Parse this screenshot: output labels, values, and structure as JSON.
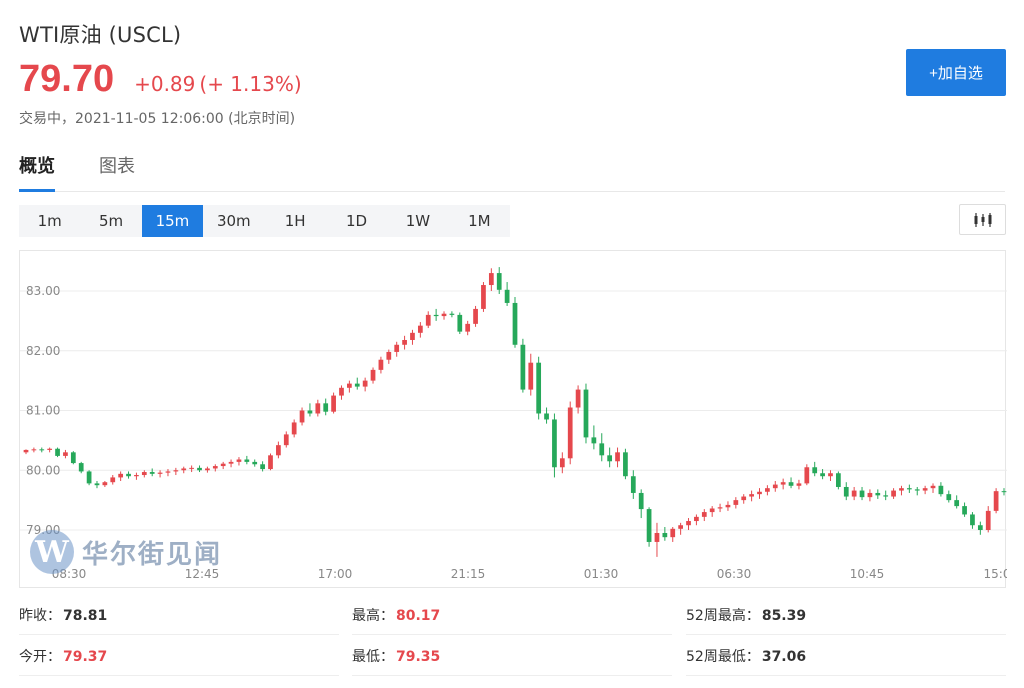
{
  "header": {
    "title": "WTI原油 (USCL)",
    "price": "79.70",
    "change": "+0.89",
    "change_pct": "(+ 1.13%)",
    "status": "交易中，2021-11-05 12:06:00 (北京时间)",
    "add_button": "+加自选"
  },
  "tabs": [
    {
      "label": "概览",
      "active": true
    },
    {
      "label": "图表",
      "active": false
    }
  ],
  "periods": [
    {
      "label": "1m",
      "active": false
    },
    {
      "label": "5m",
      "active": false
    },
    {
      "label": "15m",
      "active": true
    },
    {
      "label": "30m",
      "active": false
    },
    {
      "label": "1H",
      "active": false
    },
    {
      "label": "1D",
      "active": false
    },
    {
      "label": "1W",
      "active": false
    },
    {
      "label": "1M",
      "active": false
    }
  ],
  "watermark": {
    "logo": "W",
    "text": "华尔街见闻"
  },
  "stats": {
    "prev_close_label": "昨收：",
    "prev_close": "78.81",
    "high_label": "最高：",
    "high": "80.17",
    "high52_label": "52周最高：",
    "high52": "85.39",
    "open_label": "今开：",
    "open": "79.37",
    "low_label": "最低：",
    "low": "79.35",
    "low52_label": "52周最低：",
    "low52": "37.06"
  },
  "colors": {
    "up": "#e5484d",
    "down": "#26a85a",
    "accent": "#1f7ce0"
  },
  "chart_data": {
    "type": "candlestick",
    "y_ticks": [
      "83.00",
      "82.00",
      "81.00",
      "80.00",
      "79.00"
    ],
    "x_ticks": [
      "08:30",
      "12:45",
      "17:00",
      "21:15",
      "01:30",
      "06:30",
      "10:45",
      "15:0"
    ],
    "ylim": [
      78.55,
      83.75
    ],
    "grid": true,
    "candles": [
      [
        80.3,
        80.35,
        80.27,
        80.34
      ],
      [
        80.34,
        80.38,
        80.3,
        80.35
      ],
      [
        80.35,
        80.38,
        80.3,
        80.34
      ],
      [
        80.34,
        80.38,
        80.3,
        80.36
      ],
      [
        80.36,
        80.38,
        80.22,
        80.24
      ],
      [
        80.24,
        80.34,
        80.2,
        80.3
      ],
      [
        80.3,
        80.32,
        80.1,
        80.12
      ],
      [
        80.12,
        80.14,
        79.95,
        79.98
      ],
      [
        79.98,
        80.0,
        79.75,
        79.78
      ],
      [
        79.78,
        79.82,
        79.7,
        79.75
      ],
      [
        79.75,
        79.82,
        79.72,
        79.8
      ],
      [
        79.8,
        79.92,
        79.76,
        79.88
      ],
      [
        79.88,
        79.98,
        79.82,
        79.94
      ],
      [
        79.94,
        79.98,
        79.86,
        79.9
      ],
      [
        79.9,
        79.96,
        79.84,
        79.92
      ],
      [
        79.92,
        80.0,
        79.88,
        79.97
      ],
      [
        79.97,
        80.03,
        79.9,
        79.94
      ],
      [
        79.94,
        80.0,
        79.88,
        79.96
      ],
      [
        79.96,
        80.02,
        79.9,
        79.98
      ],
      [
        79.98,
        80.04,
        79.92,
        80.0
      ],
      [
        80.0,
        80.06,
        79.95,
        80.03
      ],
      [
        80.03,
        80.08,
        79.97,
        80.04
      ],
      [
        80.04,
        80.08,
        79.97,
        80.0
      ],
      [
        80.0,
        80.06,
        79.96,
        80.03
      ],
      [
        80.03,
        80.1,
        79.98,
        80.07
      ],
      [
        80.07,
        80.14,
        80.02,
        80.11
      ],
      [
        80.11,
        80.18,
        80.05,
        80.14
      ],
      [
        80.14,
        80.22,
        80.08,
        80.18
      ],
      [
        80.18,
        80.24,
        80.1,
        80.14
      ],
      [
        80.14,
        80.18,
        80.06,
        80.1
      ],
      [
        80.1,
        80.15,
        79.98,
        80.02
      ],
      [
        80.02,
        80.28,
        80.0,
        80.25
      ],
      [
        80.25,
        80.48,
        80.2,
        80.42
      ],
      [
        80.42,
        80.65,
        80.38,
        80.6
      ],
      [
        80.6,
        80.85,
        80.55,
        80.8
      ],
      [
        80.8,
        81.05,
        80.75,
        81.0
      ],
      [
        81.0,
        81.12,
        80.9,
        80.95
      ],
      [
        80.95,
        81.18,
        80.9,
        81.12
      ],
      [
        81.12,
        81.2,
        80.92,
        80.98
      ],
      [
        80.98,
        81.3,
        80.95,
        81.25
      ],
      [
        81.25,
        81.42,
        81.18,
        81.38
      ],
      [
        81.38,
        81.5,
        81.3,
        81.45
      ],
      [
        81.45,
        81.55,
        81.35,
        81.4
      ],
      [
        81.4,
        81.55,
        81.32,
        81.5
      ],
      [
        81.5,
        81.72,
        81.45,
        81.68
      ],
      [
        81.68,
        81.9,
        81.62,
        81.85
      ],
      [
        81.85,
        82.02,
        81.78,
        81.98
      ],
      [
        81.98,
        82.15,
        81.9,
        82.1
      ],
      [
        82.1,
        82.25,
        82.02,
        82.18
      ],
      [
        82.18,
        82.35,
        82.1,
        82.3
      ],
      [
        82.3,
        82.48,
        82.22,
        82.42
      ],
      [
        82.42,
        82.66,
        82.38,
        82.6
      ],
      [
        82.6,
        82.7,
        82.5,
        82.58
      ],
      [
        82.58,
        82.66,
        82.52,
        82.62
      ],
      [
        82.62,
        82.66,
        82.56,
        82.6
      ],
      [
        82.6,
        82.64,
        82.28,
        82.32
      ],
      [
        82.32,
        82.5,
        82.26,
        82.45
      ],
      [
        82.45,
        82.75,
        82.4,
        82.7
      ],
      [
        82.7,
        83.15,
        82.65,
        83.1
      ],
      [
        83.1,
        83.38,
        83.0,
        83.3
      ],
      [
        83.3,
        83.4,
        82.95,
        83.02
      ],
      [
        83.02,
        83.15,
        82.75,
        82.8
      ],
      [
        82.8,
        82.9,
        82.05,
        82.1
      ],
      [
        82.1,
        82.2,
        81.3,
        81.35
      ],
      [
        81.35,
        81.95,
        81.25,
        81.8
      ],
      [
        81.8,
        81.9,
        80.85,
        80.95
      ],
      [
        80.95,
        81.05,
        80.78,
        80.85
      ],
      [
        80.85,
        80.95,
        79.88,
        80.05
      ],
      [
        80.05,
        80.3,
        79.95,
        80.2
      ],
      [
        80.2,
        81.15,
        80.1,
        81.05
      ],
      [
        81.05,
        81.42,
        80.95,
        81.35
      ],
      [
        81.35,
        81.45,
        80.45,
        80.55
      ],
      [
        80.55,
        80.75,
        80.35,
        80.45
      ],
      [
        80.45,
        80.62,
        80.15,
        80.25
      ],
      [
        80.25,
        80.38,
        80.05,
        80.15
      ],
      [
        80.15,
        80.38,
        80.05,
        80.3
      ],
      [
        80.3,
        80.36,
        79.85,
        79.9
      ],
      [
        79.9,
        80.0,
        79.52,
        79.62
      ],
      [
        79.62,
        79.68,
        79.2,
        79.35
      ],
      [
        79.35,
        79.38,
        78.72,
        78.8
      ],
      [
        78.8,
        79.12,
        78.55,
        78.95
      ],
      [
        78.95,
        79.05,
        78.82,
        78.88
      ],
      [
        78.88,
        79.05,
        78.8,
        79.02
      ],
      [
        79.02,
        79.12,
        78.92,
        79.08
      ],
      [
        79.08,
        79.2,
        79.0,
        79.15
      ],
      [
        79.15,
        79.26,
        79.08,
        79.22
      ],
      [
        79.22,
        79.35,
        79.15,
        79.3
      ],
      [
        79.3,
        79.4,
        79.22,
        79.36
      ],
      [
        79.36,
        79.44,
        79.3,
        79.38
      ],
      [
        79.38,
        79.48,
        79.32,
        79.42
      ],
      [
        79.42,
        79.55,
        79.36,
        79.5
      ],
      [
        79.5,
        79.6,
        79.44,
        79.56
      ],
      [
        79.56,
        79.66,
        79.48,
        79.6
      ],
      [
        79.6,
        79.7,
        79.52,
        79.64
      ],
      [
        79.64,
        79.75,
        79.58,
        79.7
      ],
      [
        79.7,
        79.82,
        79.64,
        79.76
      ],
      [
        79.76,
        79.86,
        79.68,
        79.8
      ],
      [
        79.8,
        79.88,
        79.7,
        79.74
      ],
      [
        79.74,
        79.84,
        79.68,
        79.78
      ],
      [
        79.78,
        80.1,
        79.75,
        80.05
      ],
      [
        80.05,
        80.14,
        79.9,
        79.95
      ],
      [
        79.95,
        80.02,
        79.85,
        79.9
      ],
      [
        79.9,
        80.0,
        79.82,
        79.95
      ],
      [
        79.95,
        79.98,
        79.68,
        79.72
      ],
      [
        79.72,
        79.8,
        79.5,
        79.56
      ],
      [
        79.56,
        79.72,
        79.5,
        79.66
      ],
      [
        79.66,
        79.72,
        79.5,
        79.55
      ],
      [
        79.55,
        79.68,
        79.48,
        79.62
      ],
      [
        79.62,
        79.68,
        79.52,
        79.58
      ],
      [
        79.58,
        79.66,
        79.5,
        79.56
      ],
      [
        79.56,
        79.7,
        79.52,
        79.66
      ],
      [
        79.66,
        79.74,
        79.58,
        79.7
      ],
      [
        79.7,
        79.76,
        79.62,
        79.68
      ],
      [
        79.68,
        79.72,
        79.58,
        79.66
      ],
      [
        79.66,
        79.74,
        79.6,
        79.7
      ],
      [
        79.7,
        79.78,
        79.62,
        79.74
      ],
      [
        79.74,
        79.8,
        79.56,
        79.6
      ],
      [
        79.6,
        79.66,
        79.46,
        79.5
      ],
      [
        79.5,
        79.58,
        79.36,
        79.4
      ],
      [
        79.4,
        79.46,
        79.22,
        79.26
      ],
      [
        79.26,
        79.3,
        79.02,
        79.08
      ],
      [
        79.08,
        79.14,
        78.92,
        79.0
      ],
      [
        79.0,
        79.4,
        78.96,
        79.32
      ],
      [
        79.32,
        79.7,
        79.28,
        79.65
      ],
      [
        79.65,
        79.7,
        79.58,
        79.64
      ]
    ]
  }
}
